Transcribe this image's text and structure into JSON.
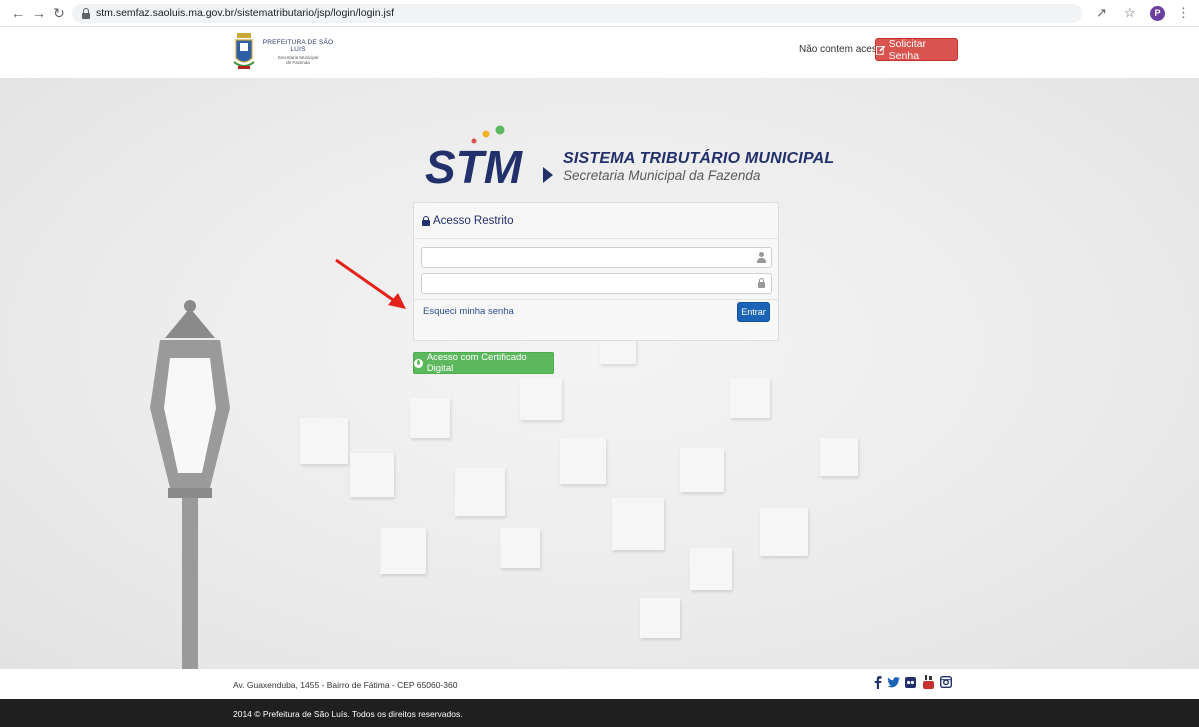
{
  "browser": {
    "back_icon": "arrow-left-icon",
    "forward_icon": "arrow-right-icon",
    "reload_icon": "reload-icon",
    "url": "stm.semfaz.saoluis.ma.gov.br/sistematributario/jsp/login/login.jsf",
    "profile_initial": "P"
  },
  "header": {
    "org_line1": "PREFEITURA DE SÃO LUIS",
    "org_line2": "Secretaria Municipal",
    "org_line3": "de Fazenda",
    "no_access_text": "Não contem acesso?",
    "request_password_label": "Solicitar Senha"
  },
  "logo": {
    "title": "SISTEMA TRIBUTÁRIO MUNICIPAL",
    "subtitle": "Secretaria Municipal da Fazenda"
  },
  "login": {
    "heading": "Acesso Restrito",
    "username_value": "",
    "password_value": "",
    "forgot_link": "Esqueci minha senha",
    "submit_label": "Entrar",
    "certificate_label": "Acesso com Certificado Digital"
  },
  "footer": {
    "address": "Av. Guaxenduba, 1455 - Bairro de Fátima - CEP 65060-360",
    "copyright": "2014 © Prefeitura de São Luís. Todos os direitos reservados.",
    "social": [
      "facebook-icon",
      "twitter-icon",
      "flickr-icon",
      "youtube-icon",
      "instagram-icon"
    ]
  },
  "colors": {
    "primary_blue": "#1a63b5",
    "danger_red": "#d9534f",
    "success_green": "#5cb85c",
    "brand_navy": "#22306b",
    "annotation_red": "#e3231b"
  }
}
